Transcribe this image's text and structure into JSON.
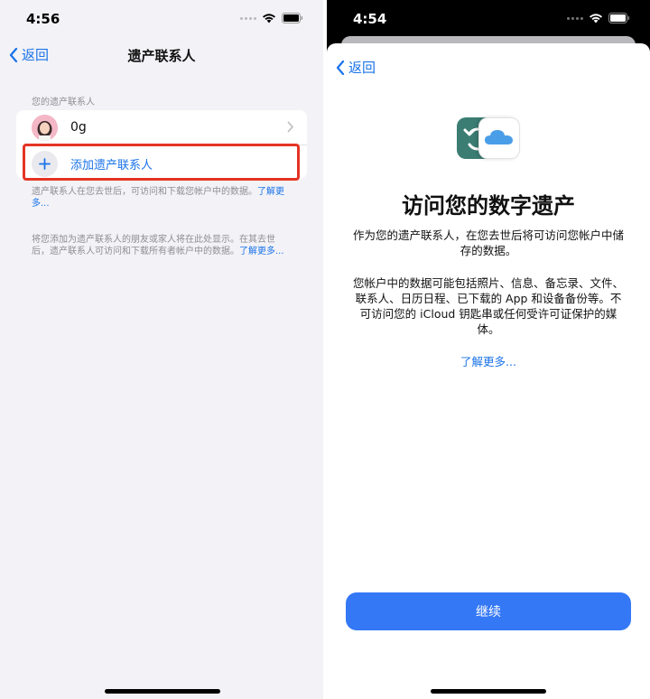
{
  "left": {
    "status": {
      "time": "4:56"
    },
    "nav": {
      "back_label": "返回",
      "title": "遗产联系人"
    },
    "section_label": "您的遗产联系人",
    "contact": {
      "name": "0g"
    },
    "add_label": "添加遗产联系人",
    "footnote1": {
      "text": "遗产联系人在您去世后，可访问和下载您帐户中的数据。",
      "link": "了解更多..."
    },
    "footnote2": {
      "text": "将您添加为遗产联系人的朋友或家人将在此处显示。在其去世后，遗产联系人可访问和下载所有者帐户中的数据。",
      "link": "了解更多..."
    }
  },
  "right": {
    "status": {
      "time": "4:54"
    },
    "nav": {
      "back_label": "返回"
    },
    "heading": "访问您的数字遗产",
    "para1": "作为您的遗产联系人，在您去世后将可访问您帐户中储存的数据。",
    "para2": "您帐户中的数据可能包括照片、信息、备忘录、文件、联系人、日历日程、已下载的 App 和设备备份等。不可访问您的 iCloud 钥匙串或任何受许可证保护的媒体。",
    "learn_more": "了解更多...",
    "continue_label": "继续"
  },
  "colors": {
    "accent": "#1a73e8",
    "button": "#3478f6",
    "highlight": "#e53424",
    "app_icon_tile": "#3b7d73"
  },
  "icons": [
    "chevron-left-icon",
    "wifi-icon",
    "battery-icon",
    "signal-dots-icon",
    "chevron-right-icon",
    "plus-icon",
    "legacy-app-icon",
    "icloud-icon"
  ]
}
